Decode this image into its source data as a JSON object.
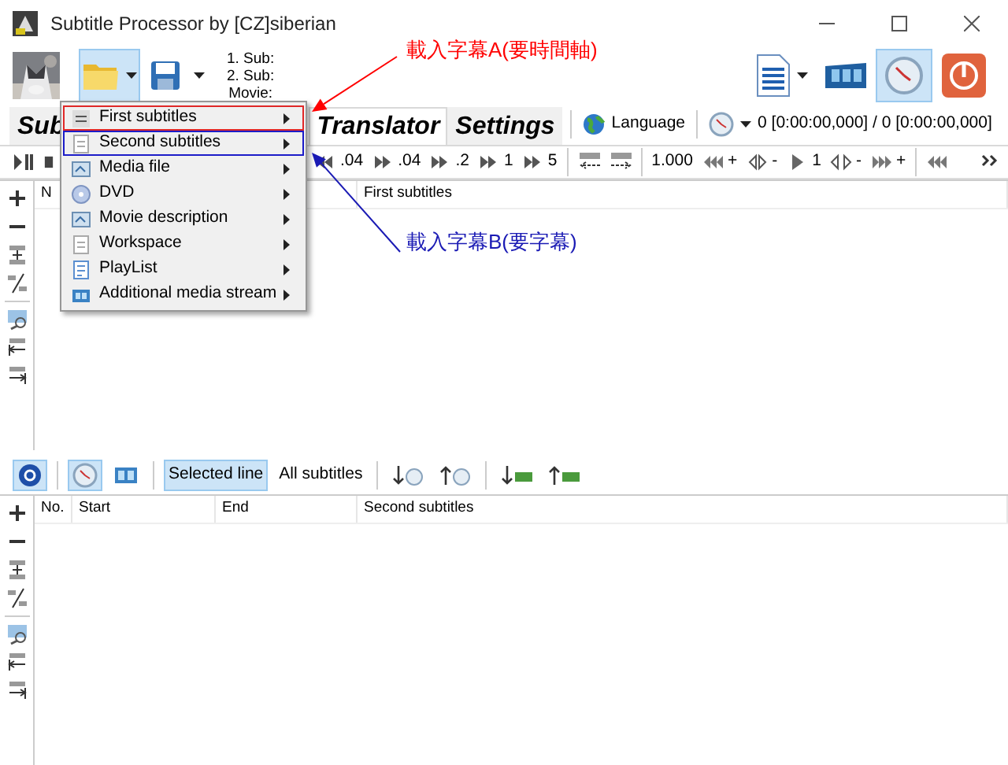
{
  "window": {
    "title": "Subtitle Processor by [CZ]siberian"
  },
  "toolbar": {
    "info_lines": [
      "1. Sub:",
      "2. Sub:",
      "Movie:"
    ],
    "right_buttons": [
      {
        "kind": "document",
        "selected": false
      },
      {
        "kind": "film",
        "selected": false
      },
      {
        "kind": "clock",
        "selected": true
      },
      {
        "kind": "power",
        "selected": false
      }
    ]
  },
  "tabs": [
    {
      "label": "Sub",
      "selected": false
    },
    {
      "label": "Translator",
      "selected": true
    },
    {
      "label": "Settings",
      "selected": false
    }
  ],
  "language_button": "Language",
  "time_readout": "0 [0:00:00,000] / 0 [0:00:00,000]",
  "player_toolbar": [
    {
      "kind": "playpause"
    },
    {
      "kind": "stop"
    },
    {
      "kind": "rewind",
      "label": ".04"
    },
    {
      "kind": "forward",
      "label": ".04"
    },
    {
      "kind": "forward",
      "label": ".2"
    },
    {
      "kind": "forward",
      "label": "1"
    },
    {
      "kind": "forward",
      "label": "5"
    },
    {
      "kind": "shiftleft"
    },
    {
      "kind": "shiftright"
    },
    {
      "kind": "text",
      "label": "1.000"
    },
    {
      "kind": "fastback",
      "label": "+"
    },
    {
      "kind": "narrow",
      "label": "-"
    },
    {
      "kind": "play",
      "label": "1"
    },
    {
      "kind": "widen",
      "label": "-"
    },
    {
      "kind": "fastfwd",
      "label": "+"
    },
    {
      "kind": "fastback"
    },
    {
      "kind": "more"
    }
  ],
  "upper_grid": {
    "columns": [
      "N",
      "First subtitles"
    ]
  },
  "lower_toolbar": [
    {
      "kind": "help",
      "selected": true
    },
    {
      "kind": "clock",
      "selected": true
    },
    {
      "kind": "film",
      "selected": false
    },
    {
      "kind": "text",
      "label": "Selected line",
      "selected": true
    },
    {
      "kind": "text",
      "label": "All subtitles",
      "selected": false
    },
    {
      "kind": "down-clock",
      "selected": false
    },
    {
      "kind": "up-clock",
      "selected": false
    },
    {
      "kind": "down-film",
      "selected": false
    },
    {
      "kind": "up-film",
      "selected": false
    }
  ],
  "lower_grid": {
    "columns": [
      "No.",
      "Start",
      "End",
      "Second subtitles"
    ]
  },
  "menu": [
    {
      "label": "First subtitles",
      "kind": "sub",
      "color": "#e02828"
    },
    {
      "label": "Second subtitles",
      "kind": "doc",
      "color": "#1c1cc8"
    },
    {
      "label": "Media file",
      "kind": "media"
    },
    {
      "label": "DVD",
      "kind": "dvd"
    },
    {
      "label": "Movie description",
      "kind": "media"
    },
    {
      "label": "Workspace",
      "kind": "doc"
    },
    {
      "label": "PlayList",
      "kind": "list"
    },
    {
      "label": "Additional media stream",
      "kind": "film"
    }
  ],
  "annotations": [
    {
      "text": "載入字幕A(要時間軸)",
      "color": "#ff0000"
    },
    {
      "text": "載入字幕B(要字幕)",
      "color": "#1a1ab4"
    }
  ]
}
